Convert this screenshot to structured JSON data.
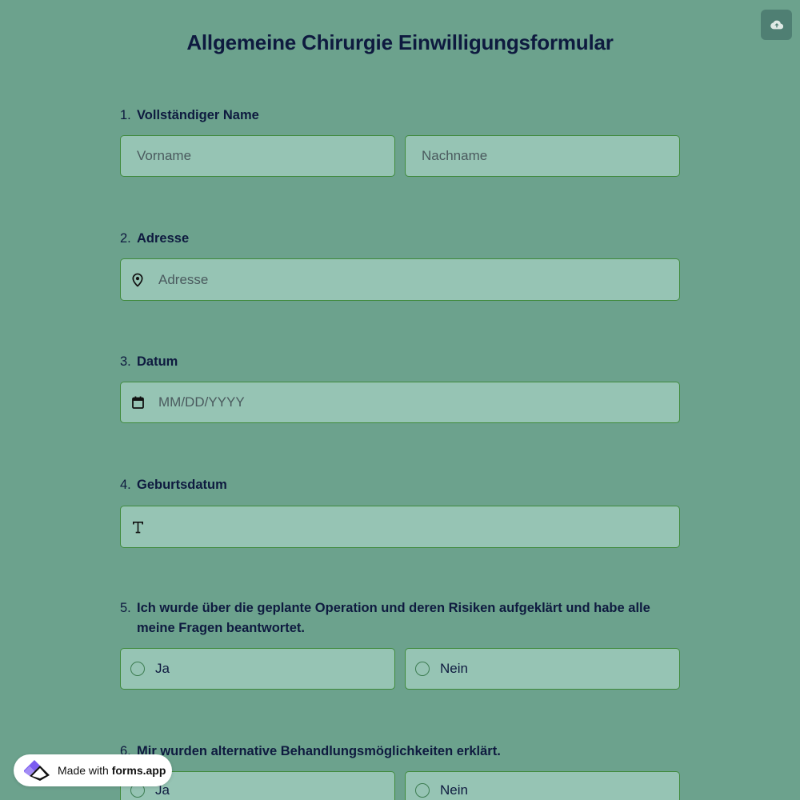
{
  "form": {
    "title": "Allgemeine Chirurgie Einwilligungsformular"
  },
  "questions": [
    {
      "number": "1.",
      "label": "Vollständiger Name",
      "first_placeholder": "Vorname",
      "last_placeholder": "Nachname"
    },
    {
      "number": "2.",
      "label": "Adresse",
      "placeholder": "Adresse",
      "icon": "location-pin-icon"
    },
    {
      "number": "3.",
      "label": "Datum",
      "placeholder": "MM/DD/YYYY",
      "icon": "calendar-icon"
    },
    {
      "number": "4.",
      "label": "Geburtsdatum",
      "icon": "text-t-icon"
    },
    {
      "number": "5.",
      "label": "Ich wurde über die geplante Operation und deren Risiken aufgeklärt und habe alle meine Fragen beantwortet.",
      "options": [
        "Ja",
        "Nein"
      ]
    },
    {
      "number": "6.",
      "label": "Mir wurden alternative Behandlungsmöglichkeiten erklärt.",
      "options": [
        "Ja",
        "Nein"
      ]
    }
  ],
  "badge": {
    "prefix": "Made with",
    "brand": "forms.app"
  },
  "colors": {
    "background": "#6ca28d",
    "field_background": "#96c4b4",
    "field_border": "#3f8a3c",
    "text": "#0e1a3f",
    "save_button": "#4f7f73",
    "logo_purple": "#7b5cf0"
  },
  "icons": {
    "save": "cloud-upload-icon"
  }
}
